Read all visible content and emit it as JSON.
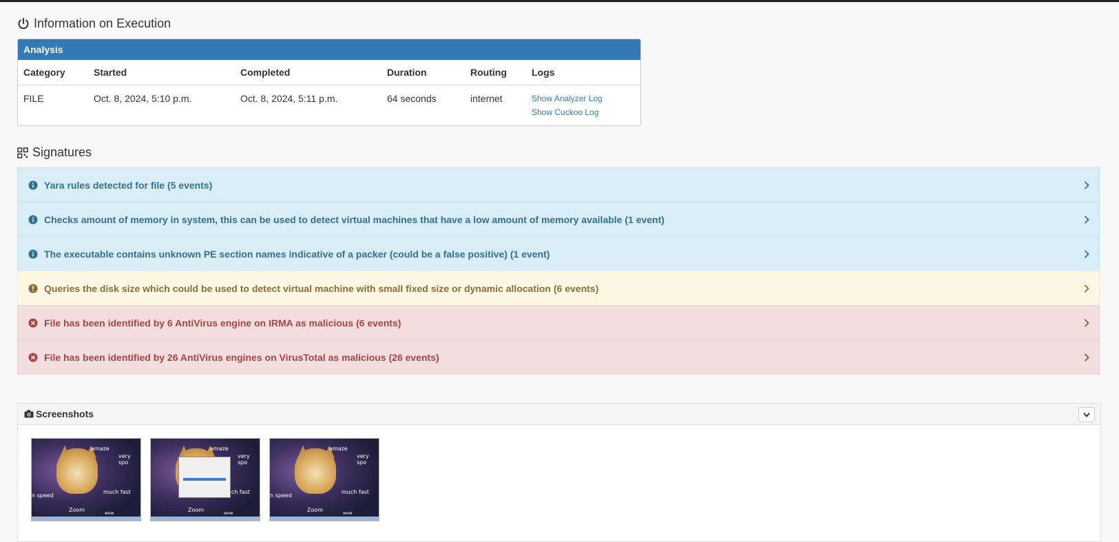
{
  "execution": {
    "title": "Information on Execution",
    "panel_title": "Analysis",
    "columns": [
      "Category",
      "Started",
      "Completed",
      "Duration",
      "Routing",
      "Logs"
    ],
    "row": {
      "category": "FILE",
      "started": "Oct. 8, 2024, 5:10 p.m.",
      "completed": "Oct. 8, 2024, 5:11 p.m.",
      "duration": "64 seconds",
      "routing": "internet",
      "logs": [
        "Show Analyzer Log",
        "Show Cuckoo Log"
      ]
    }
  },
  "signatures": {
    "title": "Signatures",
    "items": [
      {
        "severity": "info",
        "text": "Yara rules detected for file (5 events)"
      },
      {
        "severity": "info",
        "text": "Checks amount of memory in system, this can be used to detect virtual machines that have a low amount of memory available (1 event)"
      },
      {
        "severity": "info",
        "text": "The executable contains unknown PE section names indicative of a packer (could be a false positive) (1 event)"
      },
      {
        "severity": "warning",
        "text": "Queries the disk size which could be used to detect virtual machine with small fixed size or dynamic allocation (6 events)"
      },
      {
        "severity": "danger",
        "text": "File has been identified by 6 AntiVirus engine on IRMA as malicious (6 events)"
      },
      {
        "severity": "danger",
        "text": "File has been identified by 26 AntiVirus engines on VirusTotal as malicious (26 events)"
      }
    ]
  },
  "screenshots": {
    "title": "Screenshots",
    "thumb_text": {
      "amaze": "amaze",
      "very": "very spo",
      "much": "much fast",
      "zoom": "Zoom",
      "speed": "n speed",
      "wow": "wow"
    },
    "items": [
      {
        "has_dialog": false
      },
      {
        "has_dialog": true
      },
      {
        "has_dialog": false
      }
    ]
  },
  "colors": {
    "primary": "#337ab7",
    "info_bg": "#d9edf7",
    "info_fg": "#31708f",
    "warning_bg": "#fcf8e3",
    "warning_fg": "#8a6d3b",
    "danger_bg": "#f2dede",
    "danger_fg": "#a94442"
  }
}
